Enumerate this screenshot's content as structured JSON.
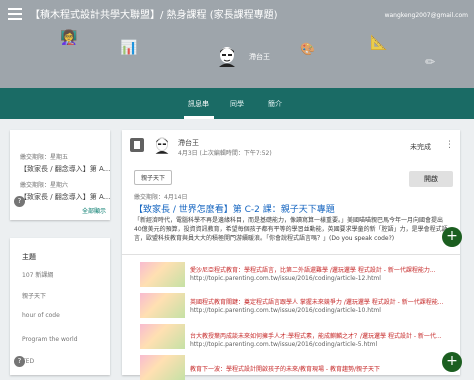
{
  "header": {
    "title": "【積木程式設計共學大聯盟】/ 熱身課程 (家長課程專題)",
    "user_email": "wangkeng2007@gmail.com",
    "owner_name": "滯台王",
    "doodles": [
      "👩‍🏫",
      "📊",
      "🎨",
      "📐",
      "✏"
    ]
  },
  "tabs": [
    {
      "label": "訊息串",
      "active": true
    },
    {
      "label": "同學",
      "active": false
    },
    {
      "label": "簡介",
      "active": false
    }
  ],
  "sidebar": {
    "announcements": [
      {
        "label": "繳交期限：星期五",
        "text": "【致家長 / 翻念導入】第 A..."
      },
      {
        "label": "繳交期限：星期六",
        "text": "【致家長 / 翻念導入】第 A..."
      }
    ],
    "show_all": "全部顯示",
    "topics_heading": "主題",
    "topics": [
      "107 新課綱",
      "親子天下",
      "hour of code",
      "Program the world",
      "TED"
    ]
  },
  "post": {
    "author": "滯台王",
    "date": "4月3日 (上次編輯時間：下午7:52)",
    "status": "未完成",
    "topic_chip": "親子天下",
    "open_button": "開啟",
    "due": "繳交期限：4月14日",
    "headline": "【致家長 / 世界怎麼看】第 C-2 課：親子天下專題",
    "body": "「新經濟時代，電腦科學不再是邊緣科目，而是基礎能力，像讀寫算一樣重要。」美國喵喵親巴馬今年一月向國會提出40億美元的預算，投資資訊教育，希望每個孩子都有平等的學習並動能，英國要求學童的新「腔語」力，是學會程式語言，歐盟科技教育與員大大的積極開門游續暖浪。「你會說程式語言嗎？」(Do you speak code?)",
    "attachments": [
      {
        "title": "愛沙尼亞程式教育：學程式語言，比第二外語還難學 /邏玩邏學 程式設計 - 新一代課程能力...",
        "url": "http://topic.parenting.com.tw/issue/2016/coding/article-12.html"
      },
      {
        "title": "英國程式教育關鍵：奠定程式語言跟學人 掌握未來競爭力 /邏玩邏學 程式設計 - 新一代課程能...",
        "url": "http://topic.parenting.com.tw/issue/2016/coding/article-10.html"
      },
      {
        "title": "台大教授葉丙成談未來如何擁手人才:學程式素，能成麒麟之才？/邏玩邏學 程式設計 - 新一代...",
        "url": "http://topic.parenting.com.tw/issue/2016/coding/article-5.html"
      },
      {
        "title": "教育下一波：學程式設計開啟孩子的未來/教育現場 - 教育趨勢/親子天下",
        "url": ""
      }
    ]
  }
}
